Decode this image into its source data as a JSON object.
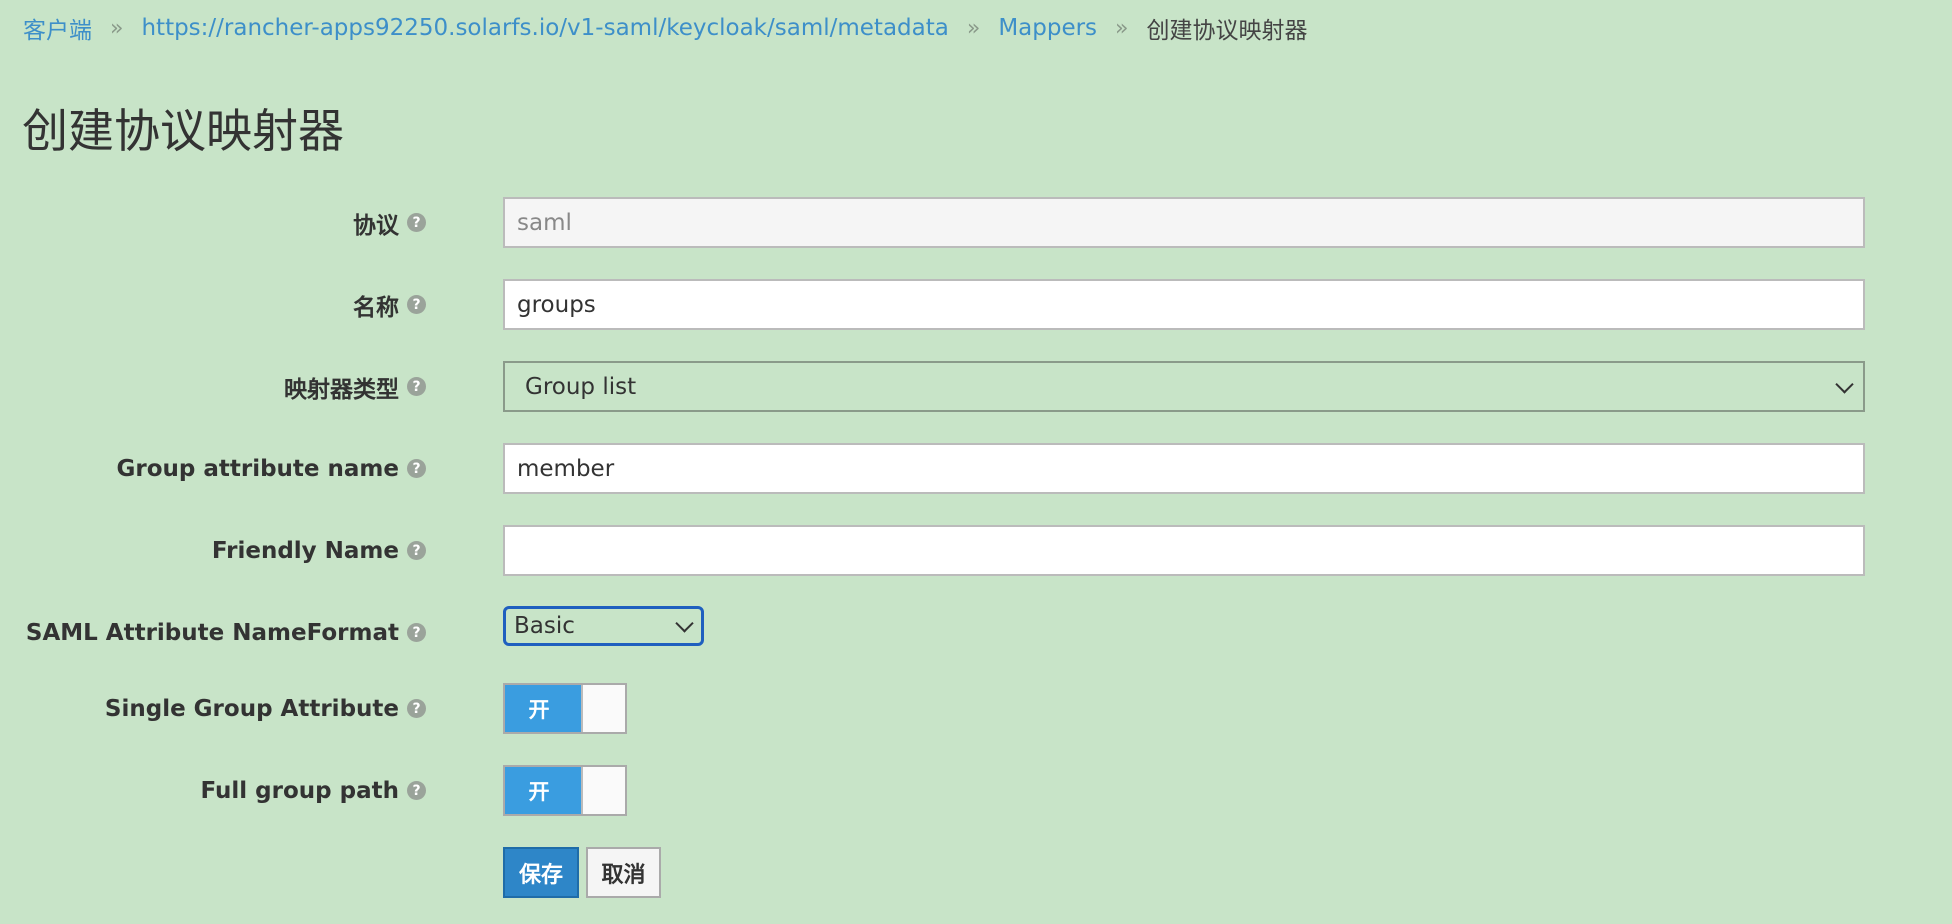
{
  "breadcrumb": {
    "items": [
      {
        "label": "客户端"
      },
      {
        "label": "https://rancher-apps92250.solarfs.io/v1-saml/keycloak/saml/metadata"
      },
      {
        "label": "Mappers"
      },
      {
        "label": "创建协议映射器"
      }
    ],
    "separator": "»"
  },
  "page_title": "创建协议映射器",
  "form": {
    "help_glyph": "?",
    "protocol": {
      "label": "协议",
      "value": "saml"
    },
    "name": {
      "label": "名称",
      "value": "groups"
    },
    "mapper_type": {
      "label": "映射器类型",
      "value": "Group list"
    },
    "group_attribute_name": {
      "label": "Group attribute name",
      "value": "member"
    },
    "friendly_name": {
      "label": "Friendly Name",
      "value": ""
    },
    "name_format": {
      "label": "SAML Attribute NameFormat",
      "value": "Basic"
    },
    "single_group_attribute": {
      "label": "Single Group Attribute",
      "toggle_label": "开",
      "on": true
    },
    "full_group_path": {
      "label": "Full group path",
      "toggle_label": "开",
      "on": true
    }
  },
  "actions": {
    "save_label": "保存",
    "cancel_label": "取消"
  },
  "colors": {
    "background": "#c8e4c8",
    "link": "#3d8fc9",
    "primary": "#2e86c8",
    "toggle_on": "#3a9de0",
    "focus_border": "#1f5fbf"
  }
}
